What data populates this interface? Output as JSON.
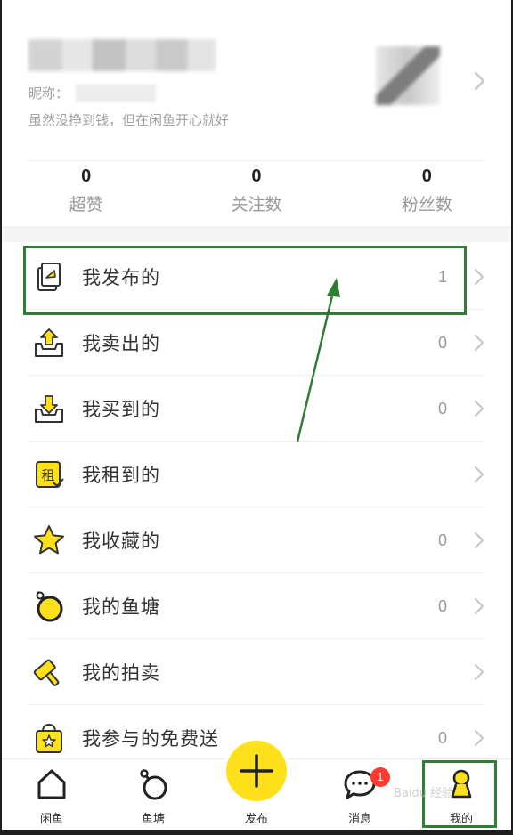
{
  "profile": {
    "nickname_label": "昵称：",
    "signature": "虽然没挣到钱，但在闲鱼开心就好"
  },
  "stats": [
    {
      "value": "0",
      "label": "超赞"
    },
    {
      "value": "0",
      "label": "关注数"
    },
    {
      "value": "0",
      "label": "粉丝数"
    }
  ],
  "menu": [
    {
      "label": "我发布的",
      "count": "1",
      "icon": "document-icon"
    },
    {
      "label": "我卖出的",
      "count": "0",
      "icon": "box-upload-icon"
    },
    {
      "label": "我买到的",
      "count": "0",
      "icon": "box-download-icon"
    },
    {
      "label": "我租到的",
      "count": "",
      "icon": "rent-icon",
      "icon_char": "租"
    },
    {
      "label": "我收藏的",
      "count": "0",
      "icon": "star-icon"
    },
    {
      "label": "我的鱼塘",
      "count": "0",
      "icon": "pond-icon"
    },
    {
      "label": "我的拍卖",
      "count": "",
      "icon": "gavel-icon"
    },
    {
      "label": "我参与的免费送",
      "count": "0",
      "icon": "gift-bag-icon"
    }
  ],
  "tabbar": [
    {
      "label": "闲鱼",
      "icon": "home-icon"
    },
    {
      "label": "鱼塘",
      "icon": "pond-tab-icon"
    },
    {
      "label": "发布",
      "icon": "plus-icon"
    },
    {
      "label": "消息",
      "icon": "chat-icon",
      "badge": "1"
    },
    {
      "label": "我的",
      "icon": "person-icon"
    }
  ],
  "watermark": "Baidu 经验",
  "colors": {
    "accent_yellow": "#ffe11b",
    "annotation_green": "#2f7d32",
    "badge_red": "#ff3b30"
  }
}
